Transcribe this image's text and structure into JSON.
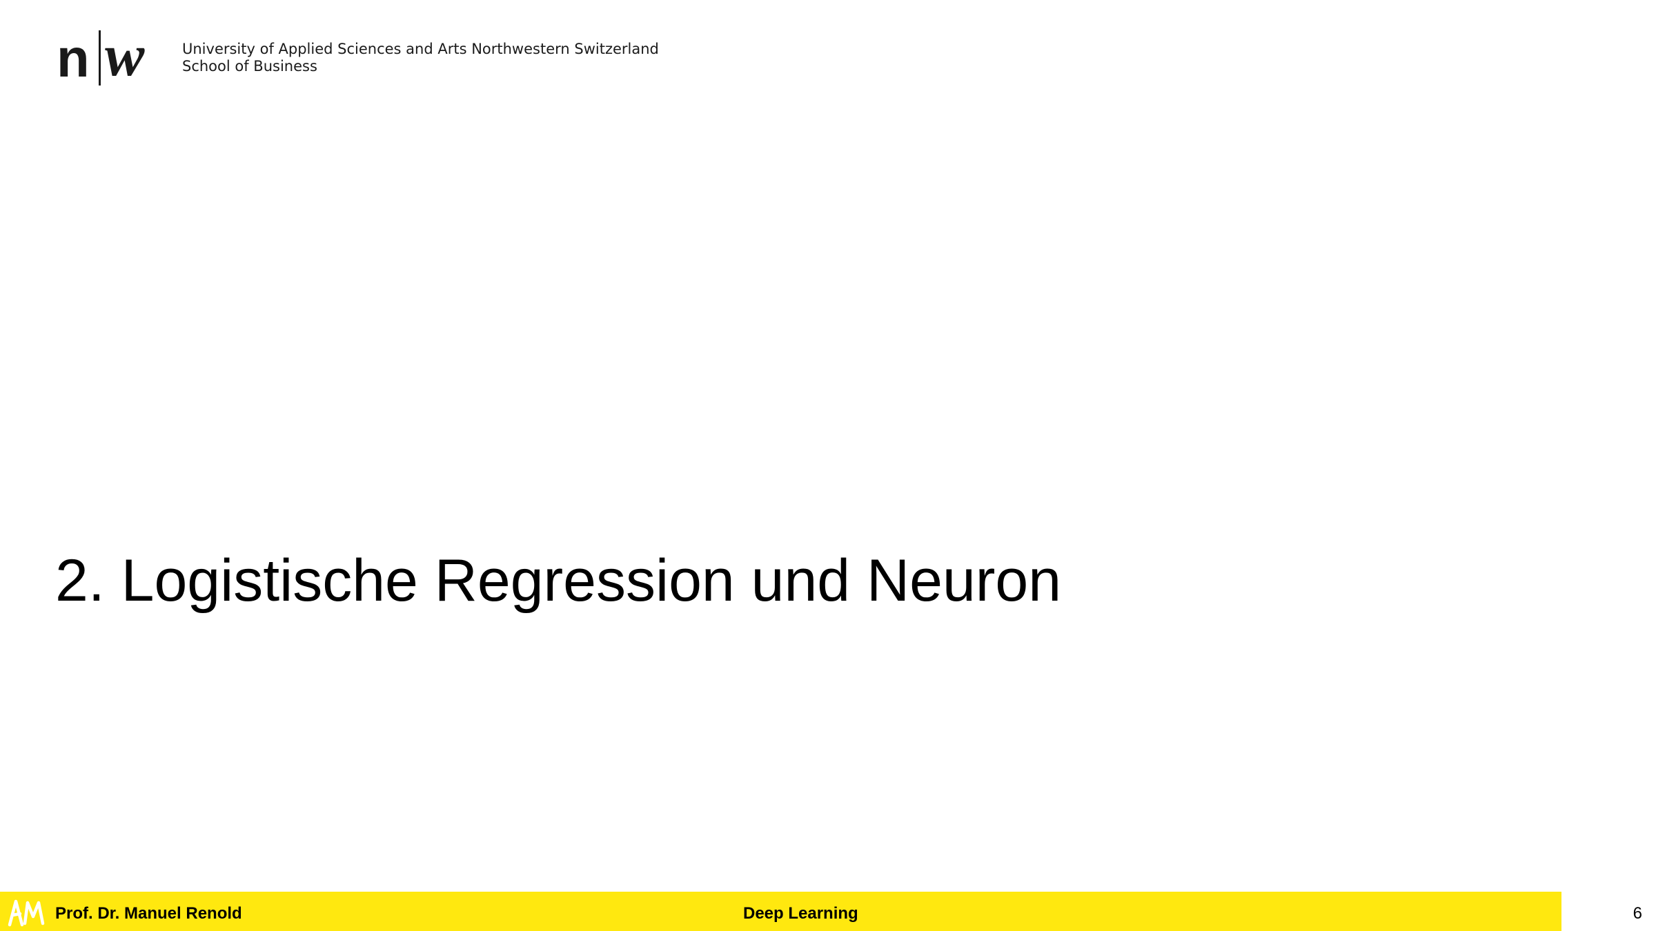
{
  "header": {
    "logo_letter_left": "n",
    "logo_letter_right": "w",
    "institution_line1": "University of Applied Sciences and Arts Northwestern Switzerland",
    "institution_line2": "School of Business"
  },
  "slide": {
    "title": "2. Logistische Regression und Neuron"
  },
  "footer": {
    "logo_icon": "am-monogram-icon",
    "author": "Prof. Dr. Manuel Renold",
    "course": "Deep Learning",
    "page_number": "6",
    "bar_color": "#ffe80f"
  }
}
